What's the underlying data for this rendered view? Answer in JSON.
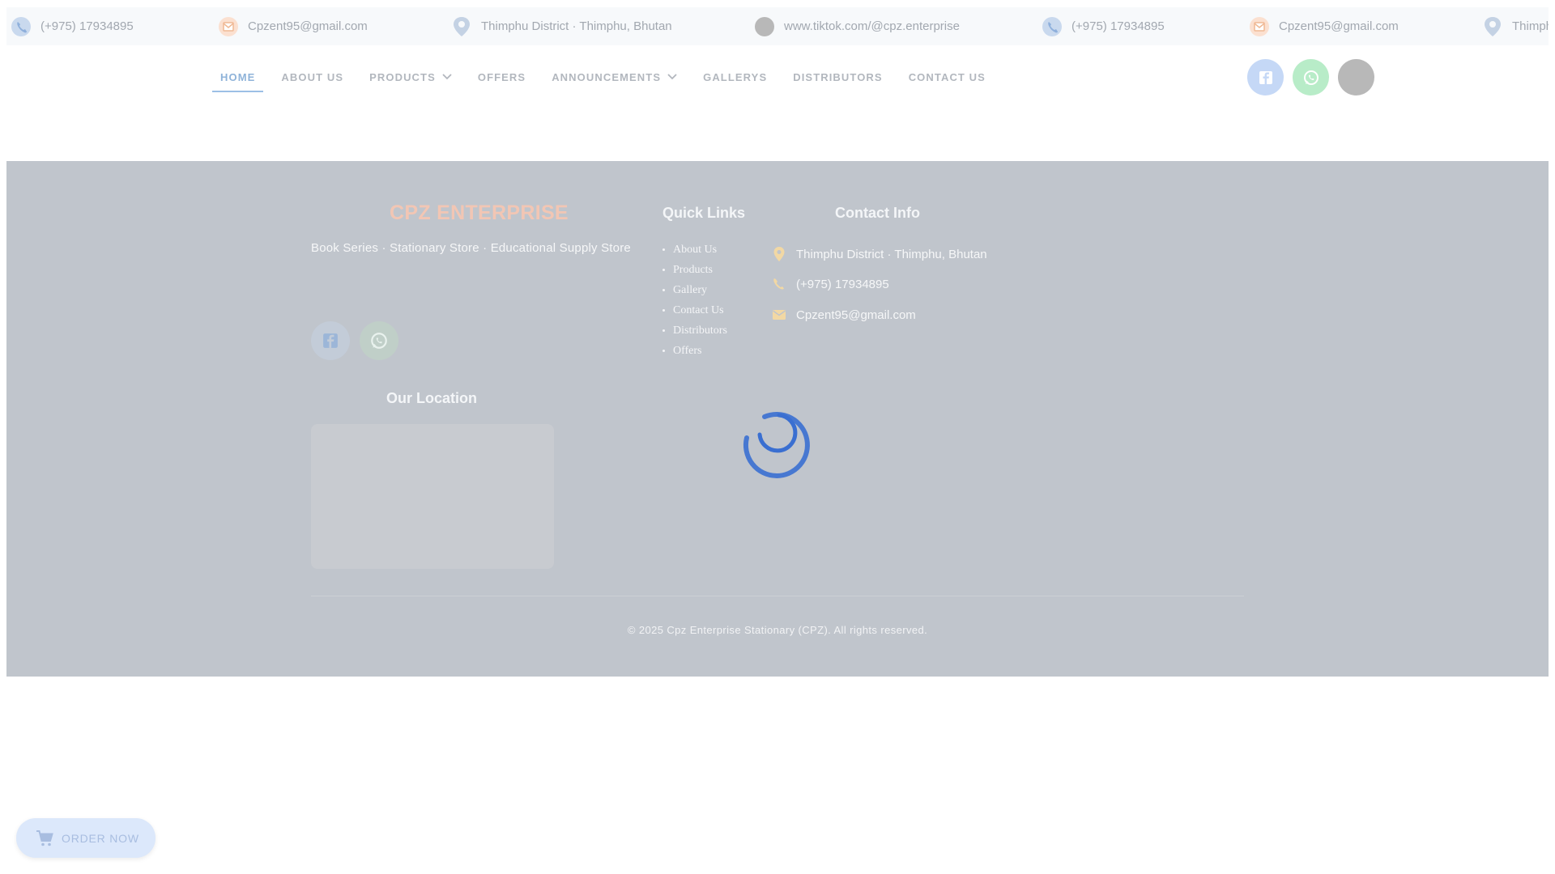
{
  "topbar": {
    "items": [
      {
        "icon": "phone-icon",
        "text": "(+975) 17934895"
      },
      {
        "icon": "mail-icon",
        "text": "Cpzent95@gmail.com"
      },
      {
        "icon": "location-icon",
        "text": "Thimphu District · Thimphu, Bhutan"
      },
      {
        "icon": "tiktok-icon",
        "text": "www.tiktok.com/@cpz.enterprise"
      },
      {
        "icon": "phone-icon",
        "text": "(+975) 17934895"
      },
      {
        "icon": "mail-icon",
        "text": "Cpzent95@gmail.com"
      },
      {
        "icon": "location-icon",
        "text": "Thimph"
      }
    ]
  },
  "nav": {
    "home": "HOME",
    "about": "ABOUT US",
    "products": "PRODUCTS",
    "offers": "OFFERS",
    "announcements": "ANNOUNCEMENTS",
    "gallerys": "GALLERYS",
    "distributors": "DISTRIBUTORS",
    "contact": "CONTACT US"
  },
  "footer": {
    "brand": "CPZ ENTERPRISE",
    "tagline": "Book Series · Stationary Store · Educational Supply Store",
    "quick_links_title": "Quick Links",
    "quick_links": [
      "About Us",
      "Products",
      "Gallery",
      "Contact Us",
      "Distributors",
      "Offers"
    ],
    "contact_title": "Contact Info",
    "contact": {
      "address": "Thimphu District · Thimphu, Bhutan",
      "phone": "(+975) 17934895",
      "email": "Cpzent95@gmail.com"
    },
    "location_title": "Our Location",
    "copyright": "© 2025 Cpz Enterprise Stationary (CPZ). All rights reserved."
  },
  "order_button": {
    "label": "ORDER NOW",
    "icon": "cart-icon"
  },
  "colors": {
    "accent_blue": "#9cc0e6",
    "overlay": "#c0c5cc",
    "brand_peach": "#f2c6b4",
    "spinner": "#3a6fd1",
    "whatsapp_green": "#b8ecc8",
    "facebook_blue": "#c5d8f6"
  }
}
